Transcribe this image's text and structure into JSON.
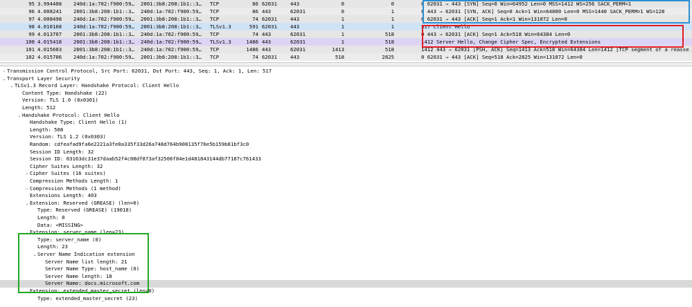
{
  "packets": [
    {
      "no": "95",
      "time": "3.994408",
      "src": "240d:1a:702:f900:59…",
      "dst": "2001:3b8:208:1b1::3…",
      "proto": "TCP",
      "len": "86",
      "sport": "62031",
      "dport": "443",
      "f1": "0",
      "f2": "0",
      "info": "0 62031 → 443 [SYN] Seq=0 Win=64952 Len=0 MSS=1412 WS=256 SACK_PERM=1",
      "style": "tcp"
    },
    {
      "no": "96",
      "time": "4.008241",
      "src": "2001:3b8:208:1b1::3…",
      "dst": "240d:1a:702:f900:59…",
      "proto": "TCP",
      "len": "86",
      "sport": "443",
      "dport": "62031",
      "f1": "0",
      "f2": "1",
      "info": "0 443 → 62031 [SYN, ACK] Seq=0 Ack=1 Win=64800 Len=0 MSS=1440 SACK_PERM=1 WS=128",
      "style": "tcp alt"
    },
    {
      "no": "97",
      "time": "4.008498",
      "src": "240d:1a:702:f900:59…",
      "dst": "2001:3b8:208:1b1::3…",
      "proto": "TCP",
      "len": "74",
      "sport": "62031",
      "dport": "443",
      "f1": "1",
      "f2": "1",
      "info": "0 62031 → 443 [ACK] Seq=1 Ack=1 Win=131072 Len=0",
      "style": "tcp"
    },
    {
      "no": "98",
      "time": "4.010168",
      "src": "240d:1a:702:f900:59…",
      "dst": "2001:3b8:208:1b1::3…",
      "proto": "TLSv1.3",
      "len": "591",
      "sport": "62031",
      "dport": "443",
      "f1": "1",
      "f2": "1",
      "info": "517 Client Hello",
      "style": "sel"
    },
    {
      "no": "99",
      "time": "4.013707",
      "src": "2001:3b8:208:1b1::3…",
      "dst": "240d:1a:702:f900:59…",
      "proto": "TCP",
      "len": "74",
      "sport": "443",
      "dport": "62031",
      "f1": "1",
      "f2": "518",
      "info": "0 443 → 62031 [ACK] Seq=1 Ack=518 Win=64384 Len=0",
      "style": "tcp"
    },
    {
      "no": "100",
      "time": "4.015418",
      "src": "2001:3b8:208:1b1::3…",
      "dst": "240d:1a:702:f900:59…",
      "proto": "TLSv1.3",
      "len": "1486",
      "sport": "443",
      "dport": "62031",
      "f1": "1",
      "f2": "518",
      "info": "1412 Server Hello, Change Cipher Spec, Encrypted Extensions",
      "style": "tls"
    },
    {
      "no": "101",
      "time": "4.015603",
      "src": "2001:3b8:208:1b1::3…",
      "dst": "240d:1a:702:f900:59…",
      "proto": "TCP",
      "len": "1486",
      "sport": "443",
      "dport": "62031",
      "f1": "1413",
      "f2": "518",
      "info": "1412 443 → 62031 [PSH, ACK] Seq=1413 Ack=518 Win=64384 Len=1412 [TCP segment of a reasse",
      "style": "tcp"
    },
    {
      "no": "102",
      "time": "4.015706",
      "src": "240d:1a:702:f900:59…",
      "dst": "2001:3b8:208:1b1::3…",
      "proto": "TCP",
      "len": "74",
      "sport": "62031",
      "dport": "443",
      "f1": "518",
      "f2": "2825",
      "info": "0 62031 → 443 [ACK] Seq=518 Ack=2825 Win=131072 Len=0",
      "style": "tcp alt"
    }
  ],
  "tree": [
    {
      "indent": 0,
      "tw": "›",
      "text": "Transmission Control Protocol, Src Port: 62031, Dst Port: 443, Seq: 1, Ack: 1, Len: 517"
    },
    {
      "indent": 0,
      "tw": "⌄",
      "text": "Transport Layer Security"
    },
    {
      "indent": 1,
      "tw": "⌄",
      "text": "TLSv1.3 Record Layer: Handshake Protocol: Client Hello"
    },
    {
      "indent": 2,
      "tw": "",
      "text": "Content Type: Handshake (22)"
    },
    {
      "indent": 2,
      "tw": "",
      "text": "Version: TLS 1.0 (0x0301)"
    },
    {
      "indent": 2,
      "tw": "",
      "text": "Length: 512"
    },
    {
      "indent": 2,
      "tw": "⌄",
      "text": "Handshake Protocol: Client Hello"
    },
    {
      "indent": 3,
      "tw": "",
      "text": "Handshake Type: Client Hello (1)"
    },
    {
      "indent": 3,
      "tw": "",
      "text": "Length: 508"
    },
    {
      "indent": 3,
      "tw": "",
      "text": "Version: TLS 1.2 (0x0303)"
    },
    {
      "indent": 3,
      "tw": "",
      "text": "Random: cdfeafad9fa6e2221a3fe0a335f33d26a748d764b908135f76e5b159b81bf3c0"
    },
    {
      "indent": 3,
      "tw": "",
      "text": "Session ID Length: 32"
    },
    {
      "indent": 3,
      "tw": "",
      "text": "Session ID: 03163dc31e37daab52f4c08df873af32506f84e1d481843144db77187c761433"
    },
    {
      "indent": 3,
      "tw": "",
      "text": "Cipher Suites Length: 32"
    },
    {
      "indent": 3,
      "tw": "›",
      "text": "Cipher Suites (16 suites)"
    },
    {
      "indent": 3,
      "tw": "",
      "text": "Compression Methods Length: 1"
    },
    {
      "indent": 3,
      "tw": "›",
      "text": "Compression Methods (1 method)"
    },
    {
      "indent": 3,
      "tw": "",
      "text": "Extensions Length: 403"
    },
    {
      "indent": 3,
      "tw": "⌄",
      "text": "Extension: Reserved (GREASE) (len=0)"
    },
    {
      "indent": 4,
      "tw": "",
      "text": "Type: Reserved (GREASE) (19018)"
    },
    {
      "indent": 4,
      "tw": "",
      "text": "Length: 0"
    },
    {
      "indent": 4,
      "tw": "",
      "text": "Data: <MISSING>"
    },
    {
      "indent": 3,
      "tw": "⌄",
      "text": "Extension: server_name (len=23)"
    },
    {
      "indent": 4,
      "tw": "",
      "text": "Type: server_name (0)"
    },
    {
      "indent": 4,
      "tw": "",
      "text": "Length: 23"
    },
    {
      "indent": 4,
      "tw": "⌄",
      "text": "Server Name Indication extension"
    },
    {
      "indent": 5,
      "tw": "",
      "text": "Server Name list length: 21"
    },
    {
      "indent": 5,
      "tw": "",
      "text": "Server Name Type: host_name (0)"
    },
    {
      "indent": 5,
      "tw": "",
      "text": "Server Name length: 18"
    },
    {
      "indent": 5,
      "tw": "",
      "text": "Server Name: docs.microsoft.com",
      "highlight": true
    },
    {
      "indent": 3,
      "tw": "⌄",
      "text": "Extension: extended_master_secret (len=0)"
    },
    {
      "indent": 4,
      "tw": "",
      "text": "Type: extended_master_secret (23)"
    }
  ]
}
